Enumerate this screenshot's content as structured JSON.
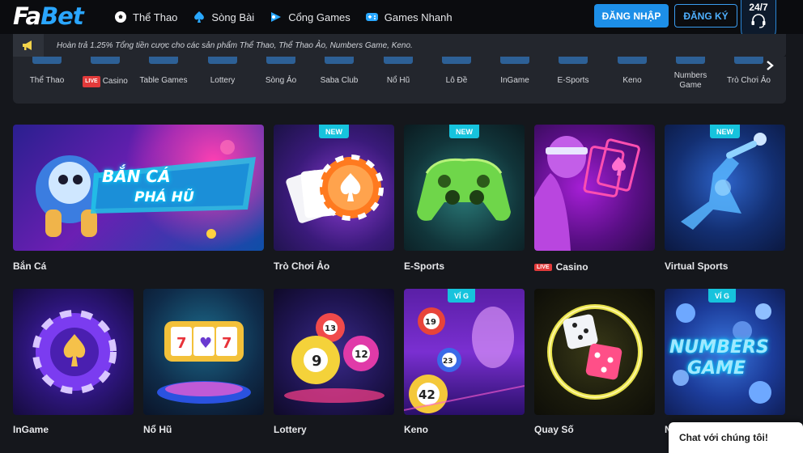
{
  "header": {
    "logo_text": "FaBet",
    "nav": [
      {
        "label": "Thể Thao",
        "icon": "soccer-ball-icon"
      },
      {
        "label": "Sòng Bài",
        "icon": "spade-icon"
      },
      {
        "label": "Cổng Games",
        "icon": "game-gate-icon"
      },
      {
        "label": "Games Nhanh",
        "icon": "quick-games-icon"
      }
    ],
    "login_label": "ĐĂNG NHẬP",
    "register_label": "ĐĂNG KÝ",
    "support_label": "24/7"
  },
  "announcement": {
    "text": "Hoàn trả 1.25% Tổng tiền cược cho các sản phẩm Thể Thao, Thể Thao Ảo, Numbers Game, Keno."
  },
  "categories": [
    {
      "label": "Thể Thao"
    },
    {
      "label": "Casino",
      "badge": "LIVE"
    },
    {
      "label": "Table Games"
    },
    {
      "label": "Lottery"
    },
    {
      "label": "Sòng Ảo"
    },
    {
      "label": "Saba Club"
    },
    {
      "label": "Nổ Hũ"
    },
    {
      "label": "Lô Đề"
    },
    {
      "label": "InGame"
    },
    {
      "label": "E-Sports"
    },
    {
      "label": "Keno"
    },
    {
      "label": "Numbers Game"
    },
    {
      "label": "Trò Chơi Ảo"
    }
  ],
  "games_row1": [
    {
      "label": "Bắn Cá",
      "banner_text_1": "BẮN CÁ",
      "banner_text_2": "PHÁ HŨ"
    },
    {
      "label": "Trò Chơi Ảo",
      "tag": "NEW"
    },
    {
      "label": "E-Sports",
      "tag": "NEW"
    },
    {
      "label": "Casino",
      "badge": "LIVE"
    },
    {
      "label": "Virtual Sports",
      "tag": "NEW"
    }
  ],
  "games_row2": [
    {
      "label": "InGame"
    },
    {
      "label": "Nổ Hũ"
    },
    {
      "label": "Lottery"
    },
    {
      "label": "Keno",
      "tag": "VÍ G",
      "balls": [
        "19",
        "23",
        "42"
      ]
    },
    {
      "label": "Quay Số"
    },
    {
      "label": "N",
      "tag": "VÍ G",
      "banner_text_1": "NUMBERS",
      "banner_text_2": "GAME"
    }
  ],
  "lottery_balls": [
    "13",
    "9",
    "12"
  ],
  "chat_label": "Chat với chúng tôi!",
  "colors": {
    "accent": "#1d8fe8",
    "tag": "#16c3dd",
    "live": "#e23a3a"
  }
}
